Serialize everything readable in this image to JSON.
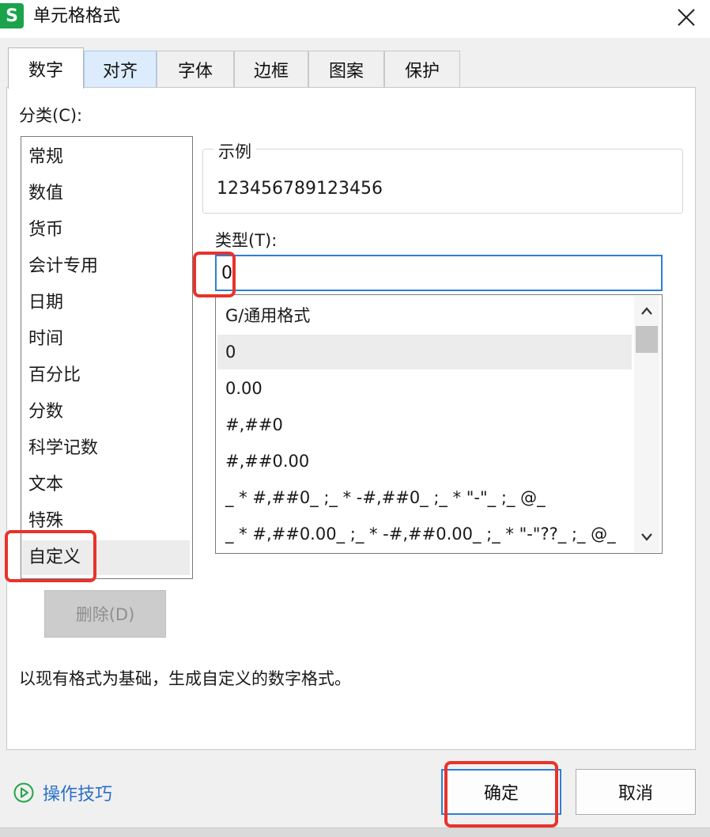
{
  "window": {
    "app_badge": "S",
    "title": "单元格格式",
    "close_icon": "close-icon"
  },
  "tabs": [
    {
      "label": "数字",
      "active": true
    },
    {
      "label": "对齐",
      "active": false
    },
    {
      "label": "字体",
      "active": false
    },
    {
      "label": "边框",
      "active": false
    },
    {
      "label": "图案",
      "active": false
    },
    {
      "label": "保护",
      "active": false
    }
  ],
  "category": {
    "label": "分类(C):",
    "items": [
      "常规",
      "数值",
      "货币",
      "会计专用",
      "日期",
      "时间",
      "百分比",
      "分数",
      "科学记数",
      "文本",
      "特殊",
      "自定义"
    ],
    "selected": "自定义"
  },
  "sample": {
    "label": "示例",
    "value": "123456789123456"
  },
  "type": {
    "label": "类型(T):",
    "value": "0"
  },
  "formats": {
    "items": [
      "G/通用格式",
      "0",
      "0.00",
      "#,##0",
      "#,##0.00",
      "_ * #,##0_ ;_ * -#,##0_ ;_ * \"-\"_ ;_ @_",
      "_ * #,##0.00_ ;_ * -#,##0.00_ ;_ * \"-\"??_ ;_ @_"
    ],
    "selected": "0"
  },
  "delete_label": "删除(D)",
  "description": "以现有格式为基础，生成自定义的数字格式。",
  "footer": {
    "tips_label": "操作技巧",
    "ok_label": "确定",
    "cancel_label": "取消"
  },
  "colors": {
    "highlight": "#e8332b",
    "accent": "#2d7fd6",
    "app_icon": "#1aa34a",
    "link": "#2a6fc9"
  }
}
